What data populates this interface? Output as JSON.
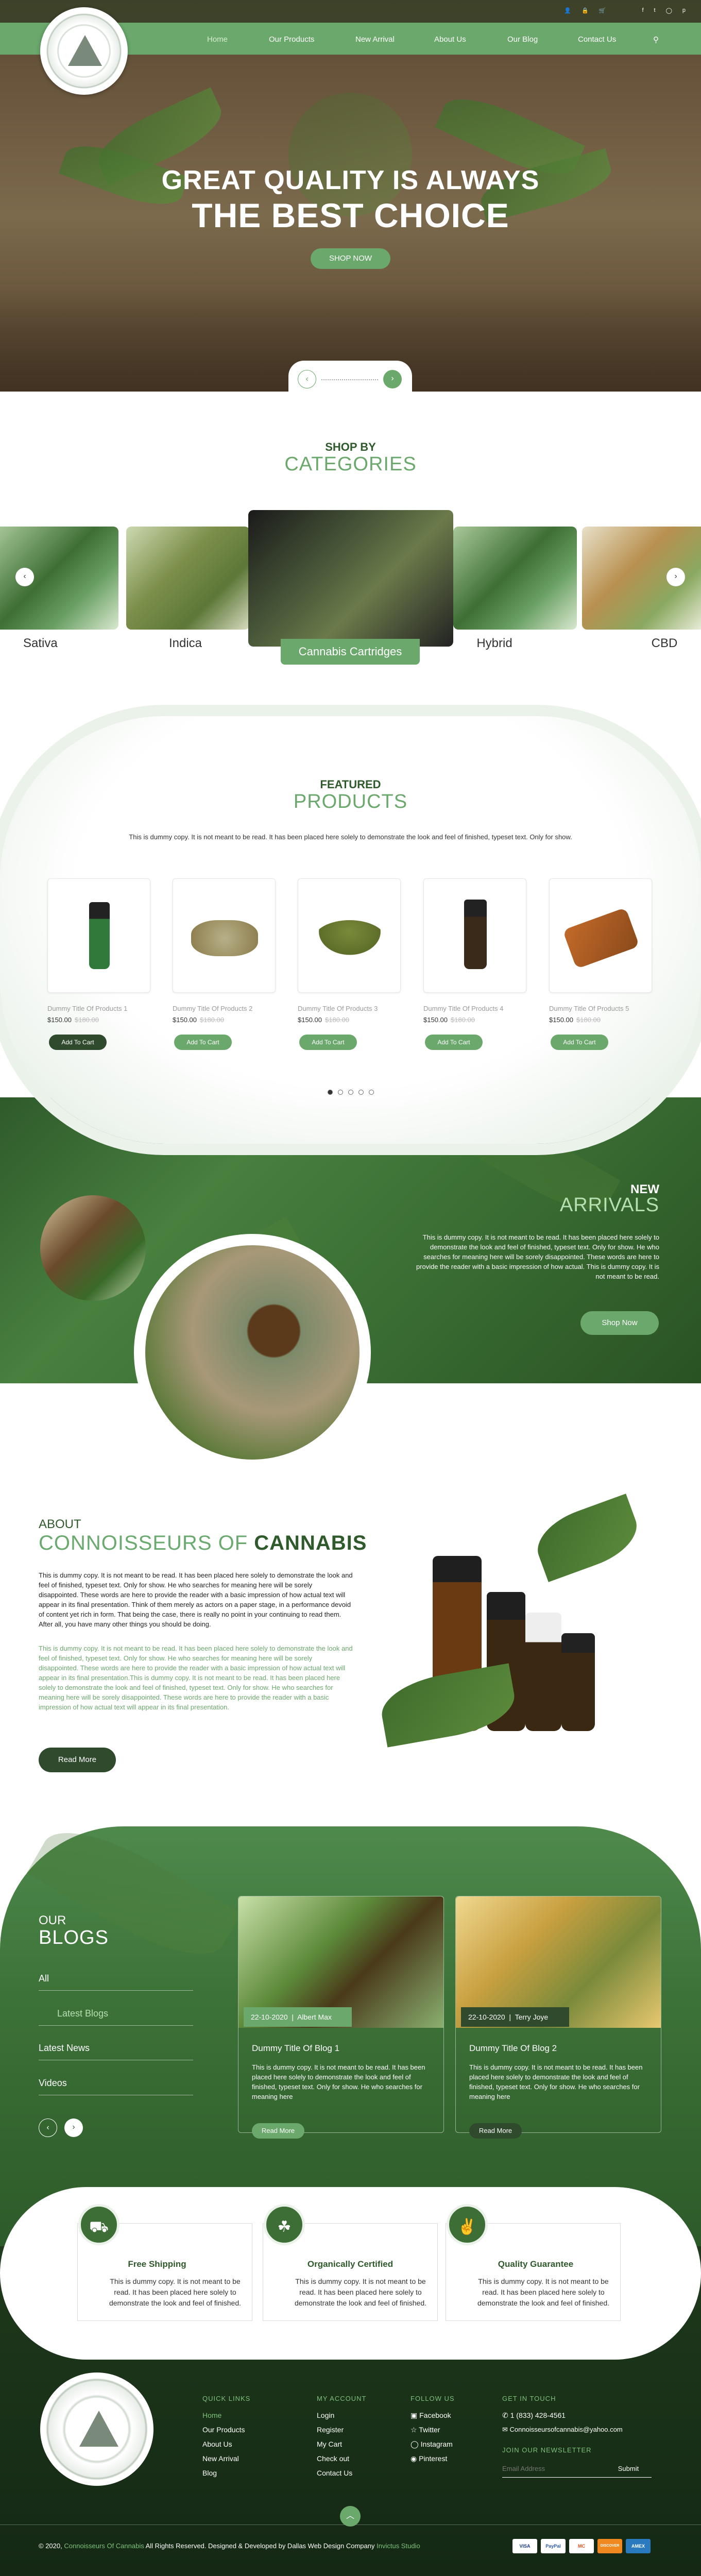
{
  "header": {
    "top_icons": [
      "user-icon",
      "lock-icon",
      "cart-icon"
    ],
    "social_icons": [
      "facebook-icon",
      "twitter-icon",
      "instagram-icon",
      "pinterest-icon"
    ],
    "nav": [
      "Home",
      "Our Products",
      "New Arrival",
      "About Us",
      "Our Blog",
      "Contact Us"
    ],
    "search_icon": "search-icon"
  },
  "hero": {
    "line1": "GREAT QUALITY IS ALWAYS",
    "line2": "THE BEST CHOICE",
    "button": "SHOP NOW",
    "prev": "‹",
    "next": "›"
  },
  "categories": {
    "kicker": "SHOP BY",
    "title": "CATEGORIES",
    "items": [
      "Sativa",
      "Indica",
      "Cannabis Cartridges",
      "Hybrid",
      "CBD"
    ],
    "prev": "‹",
    "next": "›"
  },
  "products": {
    "kicker": "FEATURED",
    "title": "PRODUCTS",
    "intro": "This is dummy copy. It is not meant to be read. It has been placed here solely to demonstrate the look and feel of finished, typeset text. Only for show.",
    "items": [
      {
        "name": "Dummy Title Of Products 1",
        "price": "$150.00",
        "old": "$180.00",
        "button": "Add To Cart"
      },
      {
        "name": "Dummy Title Of Products 2",
        "price": "$150.00",
        "old": "$180.00",
        "button": "Add To Cart"
      },
      {
        "name": "Dummy Title Of Products 3",
        "price": "$150.00",
        "old": "$180.00",
        "button": "Add To Cart"
      },
      {
        "name": "Dummy Title Of Products 4",
        "price": "$150.00",
        "old": "$180.00",
        "button": "Add To Cart"
      },
      {
        "name": "Dummy Title Of Products 5",
        "price": "$150.00",
        "old": "$180.00",
        "button": "Add To Cart"
      }
    ]
  },
  "arrivals": {
    "kicker": "NEW",
    "title": "ARRIVALS",
    "text": "This is dummy copy. It is not meant to be read. It has been placed here solely to demonstrate the look and feel of finished, typeset text. Only for show. He who searches for meaning here will be sorely disappointed. These words are here to provide the reader with a basic impression of how actual. This is dummy copy. It is not meant to be read.",
    "button": "Shop Now"
  },
  "about": {
    "kicker": "ABOUT",
    "title_a": "CONNOISSEURS OF",
    "title_b": "CANNABIS",
    "para1": "This is dummy copy. It is not meant to be read. It has been placed here solely to demonstrate the look and feel of finished, typeset text. Only for show. He who searches for meaning here will be sorely disappointed. These words are here to provide the reader with a basic impression of how actual text will appear in its final presentation. Think of them merely as actors on a paper stage, in a performance devoid of content yet rich in form. That being the case, there is really no point in your continuing to read them. After all, you have many other things you should be doing.",
    "para2": "This is dummy copy. It is not meant to be read. It has been placed here solely to demonstrate the look and feel of finished, typeset text. Only for show. He who searches for meaning here will be sorely disappointed. These words are here to provide the reader with a basic impression of how actual text will appear in its final presentation.This is dummy copy. It is not meant to be read. It has been placed here solely to demonstrate the look and feel of finished, typeset text. Only for show. He who searches for meaning here will be sorely disappointed. These words are here to provide the reader with a basic impression of how actual text will appear in its final presentation.",
    "button": "Read More"
  },
  "blogs": {
    "kicker": "OUR",
    "title": "BLOGS",
    "menu": [
      "All",
      "Latest Blogs",
      "Latest News",
      "Videos"
    ],
    "cards": [
      {
        "date": "22-10-2020",
        "author": "Albert Max",
        "title": "Dummy Title Of Blog 1",
        "text": "This is dummy copy. It is not meant to be read. It has been placed here solely to demonstrate the look and feel of finished, typeset text. Only for show. He who searches for meaning here",
        "button": "Read More"
      },
      {
        "date": "22-10-2020",
        "author": "Terry Joye",
        "title": "Dummy Title Of Blog 2",
        "text": "This is dummy copy. It is not meant to be read. It has been placed here solely to demonstrate the look and feel of finished, typeset text. Only for show. He who searches for meaning here",
        "button": "Read More"
      }
    ],
    "prev": "‹",
    "next": "›"
  },
  "features": [
    {
      "title": "Free Shipping",
      "text": "This is dummy copy. It is not meant to be read. It has been placed here solely to demonstrate the look and feel of finished.",
      "icon": "truck-icon"
    },
    {
      "title": "Organically Certified",
      "text": "This is dummy copy. It is not meant to be read. It has been placed here solely to demonstrate the look and feel of finished.",
      "icon": "sprout-icon"
    },
    {
      "title": "Quality Guarantee",
      "text": "This is dummy copy. It is not meant to be read. It has been placed here solely to demonstrate the look and feel of finished.",
      "icon": "thumbs-up-icon"
    }
  ],
  "footer": {
    "quick_links_title": "QUICK LINKS",
    "quick_links": [
      "Home",
      "Our Products",
      "About Us",
      "New Arrival",
      "Blog"
    ],
    "account_title": "MY ACCOUNT",
    "account_links": [
      "Login",
      "Register",
      "My Cart",
      "Check out",
      "Contact Us"
    ],
    "follow_title": "FOLLOW US",
    "follow_links": [
      "Facebook",
      "Twitter",
      "Instagram",
      "Pinterest"
    ],
    "touch_title": "GET IN TOUCH",
    "phone": "1 (833) 428-4561",
    "email": "Connoisseursofcannabis@yahoo.com",
    "newsletter_title": "JOIN OUR NEWSLETTER",
    "newsletter_placeholder": "Email Address",
    "newsletter_button": "Submit",
    "copy_a": "© 2020,",
    "copy_brand": "Connoisseurs Of Cannabis",
    "copy_b": "All Rights Reserved. Designed & Developed by Dallas Web Design Company",
    "copy_studio": "Invictus Studio",
    "payments": [
      "VISA",
      "PayPal",
      "MC",
      "DISCOVER",
      "AMEX"
    ],
    "top_button": "︿"
  },
  "colors": {
    "accent": "#6aa86c",
    "dark_green": "#2f5a2b"
  }
}
